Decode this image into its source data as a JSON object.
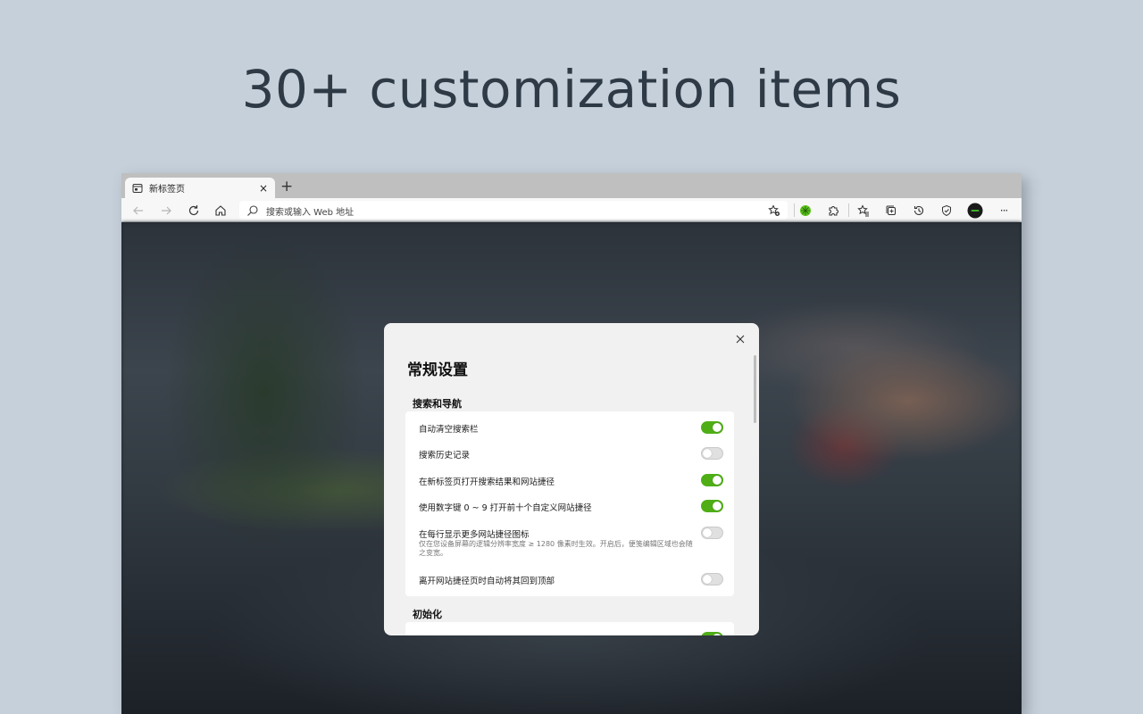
{
  "headline": "30+ customization items",
  "colors": {
    "accent_toggle_on": "#4fae16",
    "background": "#c6d0da"
  },
  "tab": {
    "title": "新标签页",
    "close": "×",
    "icon": "tab-page-icon"
  },
  "new_tab": "+",
  "toolbar": {
    "address_placeholder": "搜索或输入 Web 地址",
    "icons": [
      "back-icon",
      "forward-icon",
      "refresh-icon",
      "home-icon",
      "search-icon",
      "add-favorite-icon",
      "extension-green-icon",
      "extensions-puzzle-icon",
      "favorites-icon",
      "collections-icon",
      "history-icon",
      "browser-essentials-icon",
      "profile-avatar-icon",
      "more-icon"
    ],
    "more": "···"
  },
  "dialog": {
    "title": "常规设置",
    "sections": [
      {
        "title": "搜索和导航",
        "items": [
          {
            "label": "自动清空搜索栏",
            "on": true
          },
          {
            "label": "搜索历史记录",
            "on": false
          },
          {
            "label": "在新标签页打开搜索结果和网站捷径",
            "on": true
          },
          {
            "label": "使用数字键 0 ~ 9 打开前十个自定义网站捷径",
            "on": true
          },
          {
            "label": "在每行显示更多网站捷径图标",
            "sub": "仅在您设备屏幕的逻辑分辨率宽度 ≥ 1280 像素时生效。开启后，便笺编辑区域也会随之变宽。",
            "on": false
          },
          {
            "label": "离开网站捷径页时自动将其回到顶部",
            "on": false
          }
        ]
      },
      {
        "title": "初始化",
        "items": [
          {
            "label": "",
            "on": true
          }
        ]
      }
    ]
  }
}
